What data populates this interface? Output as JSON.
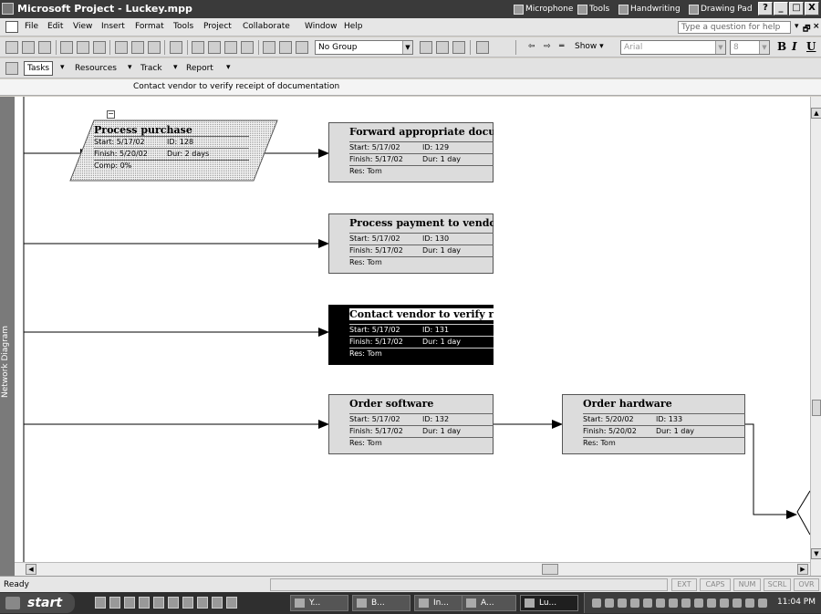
{
  "window": {
    "title": "Microsoft Project - Luckey.mpp",
    "language_bar": [
      "Microphone",
      "Tools",
      "Handwriting",
      "Drawing Pad"
    ],
    "controls": [
      "?",
      "_",
      "□",
      "X"
    ]
  },
  "menu": {
    "items": [
      "File",
      "Edit",
      "View",
      "Insert",
      "Format",
      "Tools",
      "Project",
      "Collaborate",
      "Window",
      "Help"
    ],
    "help_placeholder": "Type a question for help",
    "doc_controls": [
      "▾",
      "🗗",
      "×"
    ]
  },
  "toolbar": {
    "group_value": "No Group",
    "show_label": "Show ▾",
    "font_value": "Arial",
    "size_value": "8",
    "bold": "B",
    "italic": "I",
    "underline": "U"
  },
  "guide": {
    "buttons": [
      "Tasks",
      "Resources",
      "Track",
      "Report"
    ]
  },
  "entry_bar": {
    "text": "Contact vendor to verify receipt of documentation"
  },
  "view_label": "Network Diagram",
  "diagram": {
    "summary": {
      "name": "Process purchase",
      "start": "Start: 5/17/02",
      "id": "ID:  128",
      "finish": "Finish: 5/20/02",
      "dur": "Dur: 2 days",
      "comp": "Comp: 0%"
    },
    "collapse_symbol": "−",
    "nodes": [
      {
        "name": "Forward appropriate docum",
        "start": "Start: 5/17/02",
        "id": "ID:  129",
        "finish": "Finish: 5/17/02",
        "dur": "Dur: 1 day",
        "res": "Res:  Tom"
      },
      {
        "name": "Process payment to vendor",
        "start": "Start: 5/17/02",
        "id": "ID:  130",
        "finish": "Finish: 5/17/02",
        "dur": "Dur: 1 day",
        "res": "Res:  Tom"
      },
      {
        "name": "Contact vendor to verify rec",
        "start": "Start: 5/17/02",
        "id": "ID:  131",
        "finish": "Finish: 5/17/02",
        "dur": "Dur: 1 day",
        "res": "Res:  Tom"
      },
      {
        "name": "Order software",
        "start": "Start: 5/17/02",
        "id": "ID:  132",
        "finish": "Finish: 5/17/02",
        "dur": "Dur: 1 day",
        "res": "Res:  Tom"
      },
      {
        "name": "Order hardware",
        "start": "Start: 5/20/02",
        "id": "ID:  133",
        "finish": "Finish: 5/20/02",
        "dur": "Dur: 1 day",
        "res": "Res:  Tom"
      }
    ]
  },
  "status": {
    "text": "Ready",
    "indicators": [
      "EXT",
      "CAPS",
      "NUM",
      "SCRL",
      "OVR"
    ]
  },
  "taskbar": {
    "start_label": "start",
    "tasks": [
      "Y...",
      "B...",
      "In...",
      "A...",
      "Lu..."
    ],
    "clock": "11:04 PM"
  }
}
